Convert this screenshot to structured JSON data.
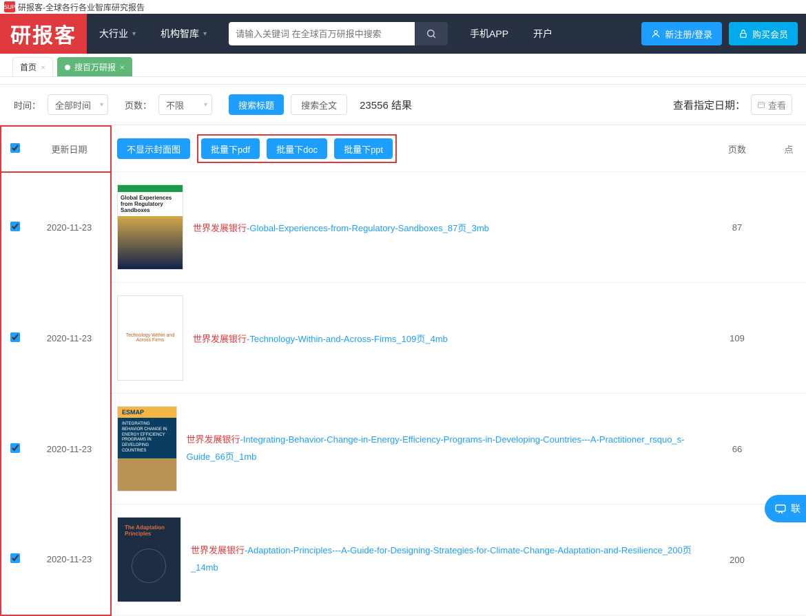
{
  "window": {
    "favicon_text": "SUP",
    "title": "研报客-全球各行各业智库研究报告"
  },
  "navbar": {
    "logo": "研报客",
    "items": [
      {
        "label": "大行业",
        "has_dropdown": true
      },
      {
        "label": "机构智库",
        "has_dropdown": true
      }
    ],
    "search_placeholder": "请输入关键词 在全球百万研报中搜索",
    "mobile_app": "手机APP",
    "open_account": "开户",
    "register_login": "新注册/登录",
    "buy_vip": "购买会员"
  },
  "tabs": [
    {
      "label": "首页",
      "active": false
    },
    {
      "label": "搜百万研报",
      "active": true
    }
  ],
  "filters": {
    "time_label": "时间：",
    "time_value": "全部时间",
    "pages_label": "页数：",
    "pages_value": "不限",
    "search_title": "搜索标题",
    "search_fulltext": "搜索全文",
    "result_count": "23556 结果",
    "view_date_label": "查看指定日期：",
    "view_date_btn": "查看"
  },
  "table": {
    "headers": {
      "date": "更新日期",
      "hide_cover": "不显示封面图",
      "pages": "页数",
      "extra": "点"
    },
    "batch": {
      "pdf": "批量下pdf",
      "doc": "批量下doc",
      "ppt": "批量下ppt"
    },
    "rows": [
      {
        "checked": true,
        "date": "2020-11-23",
        "prefix": "世界发展银行",
        "suffix": "-Global-Experiences-from-Regulatory-Sandboxes_87页_3mb",
        "pages": "87",
        "cover_title": "Global Experiences from Regulatory Sandboxes"
      },
      {
        "checked": true,
        "date": "2020-11-23",
        "prefix": "世界发展银行",
        "suffix": "-Technology-Within-and-Across-Firms_109页_4mb",
        "pages": "109",
        "cover_title": "Technology Within and Across Firms"
      },
      {
        "checked": true,
        "date": "2020-11-23",
        "prefix": "世界发展银行",
        "suffix": "-Integrating-Behavior-Change-in-Energy-Efficiency-Programs-in-Developing-Countries---A-Practitioner_rsquo_s-Guide_66页_1mb",
        "pages": "66",
        "cover_title": "ESMAP"
      },
      {
        "checked": true,
        "date": "2020-11-23",
        "prefix": "世界发展银行",
        "suffix": "-Adaptation-Principles---A-Guide-for-Designing-Strategies-for-Climate-Change-Adaptation-and-Resilience_200页_14mb",
        "pages": "200",
        "cover_title": "The Adaptation Principles"
      }
    ]
  },
  "contact": {
    "label": "联"
  }
}
